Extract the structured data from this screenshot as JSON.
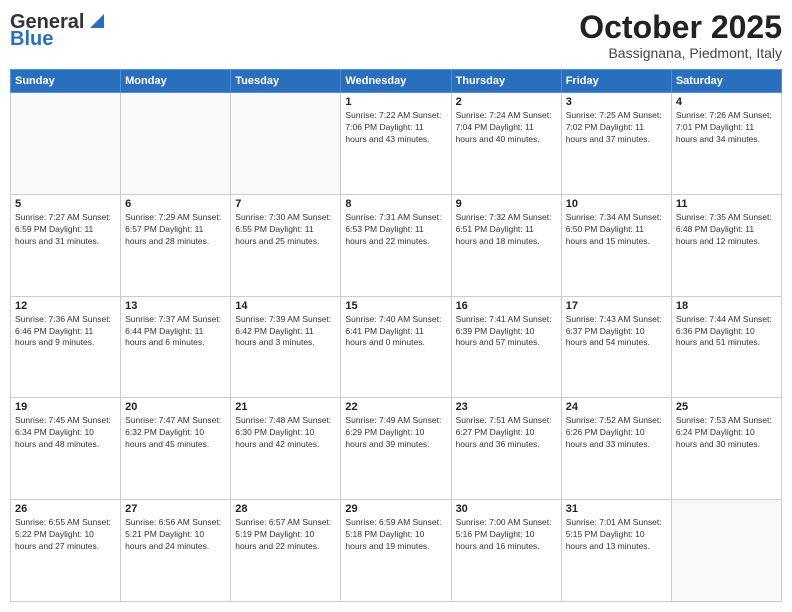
{
  "logo": {
    "line1": "General",
    "line2": "Blue"
  },
  "header": {
    "month": "October 2025",
    "location": "Bassignana, Piedmont, Italy"
  },
  "days_of_week": [
    "Sunday",
    "Monday",
    "Tuesday",
    "Wednesday",
    "Thursday",
    "Friday",
    "Saturday"
  ],
  "weeks": [
    [
      {
        "day": "",
        "info": ""
      },
      {
        "day": "",
        "info": ""
      },
      {
        "day": "",
        "info": ""
      },
      {
        "day": "1",
        "info": "Sunrise: 7:22 AM\nSunset: 7:06 PM\nDaylight: 11 hours\nand 43 minutes."
      },
      {
        "day": "2",
        "info": "Sunrise: 7:24 AM\nSunset: 7:04 PM\nDaylight: 11 hours\nand 40 minutes."
      },
      {
        "day": "3",
        "info": "Sunrise: 7:25 AM\nSunset: 7:02 PM\nDaylight: 11 hours\nand 37 minutes."
      },
      {
        "day": "4",
        "info": "Sunrise: 7:26 AM\nSunset: 7:01 PM\nDaylight: 11 hours\nand 34 minutes."
      }
    ],
    [
      {
        "day": "5",
        "info": "Sunrise: 7:27 AM\nSunset: 6:59 PM\nDaylight: 11 hours\nand 31 minutes."
      },
      {
        "day": "6",
        "info": "Sunrise: 7:29 AM\nSunset: 6:57 PM\nDaylight: 11 hours\nand 28 minutes."
      },
      {
        "day": "7",
        "info": "Sunrise: 7:30 AM\nSunset: 6:55 PM\nDaylight: 11 hours\nand 25 minutes."
      },
      {
        "day": "8",
        "info": "Sunrise: 7:31 AM\nSunset: 6:53 PM\nDaylight: 11 hours\nand 22 minutes."
      },
      {
        "day": "9",
        "info": "Sunrise: 7:32 AM\nSunset: 6:51 PM\nDaylight: 11 hours\nand 18 minutes."
      },
      {
        "day": "10",
        "info": "Sunrise: 7:34 AM\nSunset: 6:50 PM\nDaylight: 11 hours\nand 15 minutes."
      },
      {
        "day": "11",
        "info": "Sunrise: 7:35 AM\nSunset: 6:48 PM\nDaylight: 11 hours\nand 12 minutes."
      }
    ],
    [
      {
        "day": "12",
        "info": "Sunrise: 7:36 AM\nSunset: 6:46 PM\nDaylight: 11 hours\nand 9 minutes."
      },
      {
        "day": "13",
        "info": "Sunrise: 7:37 AM\nSunset: 6:44 PM\nDaylight: 11 hours\nand 6 minutes."
      },
      {
        "day": "14",
        "info": "Sunrise: 7:39 AM\nSunset: 6:42 PM\nDaylight: 11 hours\nand 3 minutes."
      },
      {
        "day": "15",
        "info": "Sunrise: 7:40 AM\nSunset: 6:41 PM\nDaylight: 11 hours\nand 0 minutes."
      },
      {
        "day": "16",
        "info": "Sunrise: 7:41 AM\nSunset: 6:39 PM\nDaylight: 10 hours\nand 57 minutes."
      },
      {
        "day": "17",
        "info": "Sunrise: 7:43 AM\nSunset: 6:37 PM\nDaylight: 10 hours\nand 54 minutes."
      },
      {
        "day": "18",
        "info": "Sunrise: 7:44 AM\nSunset: 6:36 PM\nDaylight: 10 hours\nand 51 minutes."
      }
    ],
    [
      {
        "day": "19",
        "info": "Sunrise: 7:45 AM\nSunset: 6:34 PM\nDaylight: 10 hours\nand 48 minutes."
      },
      {
        "day": "20",
        "info": "Sunrise: 7:47 AM\nSunset: 6:32 PM\nDaylight: 10 hours\nand 45 minutes."
      },
      {
        "day": "21",
        "info": "Sunrise: 7:48 AM\nSunset: 6:30 PM\nDaylight: 10 hours\nand 42 minutes."
      },
      {
        "day": "22",
        "info": "Sunrise: 7:49 AM\nSunset: 6:29 PM\nDaylight: 10 hours\nand 39 minutes."
      },
      {
        "day": "23",
        "info": "Sunrise: 7:51 AM\nSunset: 6:27 PM\nDaylight: 10 hours\nand 36 minutes."
      },
      {
        "day": "24",
        "info": "Sunrise: 7:52 AM\nSunset: 6:26 PM\nDaylight: 10 hours\nand 33 minutes."
      },
      {
        "day": "25",
        "info": "Sunrise: 7:53 AM\nSunset: 6:24 PM\nDaylight: 10 hours\nand 30 minutes."
      }
    ],
    [
      {
        "day": "26",
        "info": "Sunrise: 6:55 AM\nSunset: 5:22 PM\nDaylight: 10 hours\nand 27 minutes."
      },
      {
        "day": "27",
        "info": "Sunrise: 6:56 AM\nSunset: 5:21 PM\nDaylight: 10 hours\nand 24 minutes."
      },
      {
        "day": "28",
        "info": "Sunrise: 6:57 AM\nSunset: 5:19 PM\nDaylight: 10 hours\nand 22 minutes."
      },
      {
        "day": "29",
        "info": "Sunrise: 6:59 AM\nSunset: 5:18 PM\nDaylight: 10 hours\nand 19 minutes."
      },
      {
        "day": "30",
        "info": "Sunrise: 7:00 AM\nSunset: 5:16 PM\nDaylight: 10 hours\nand 16 minutes."
      },
      {
        "day": "31",
        "info": "Sunrise: 7:01 AM\nSunset: 5:15 PM\nDaylight: 10 hours\nand 13 minutes."
      },
      {
        "day": "",
        "info": ""
      }
    ]
  ]
}
